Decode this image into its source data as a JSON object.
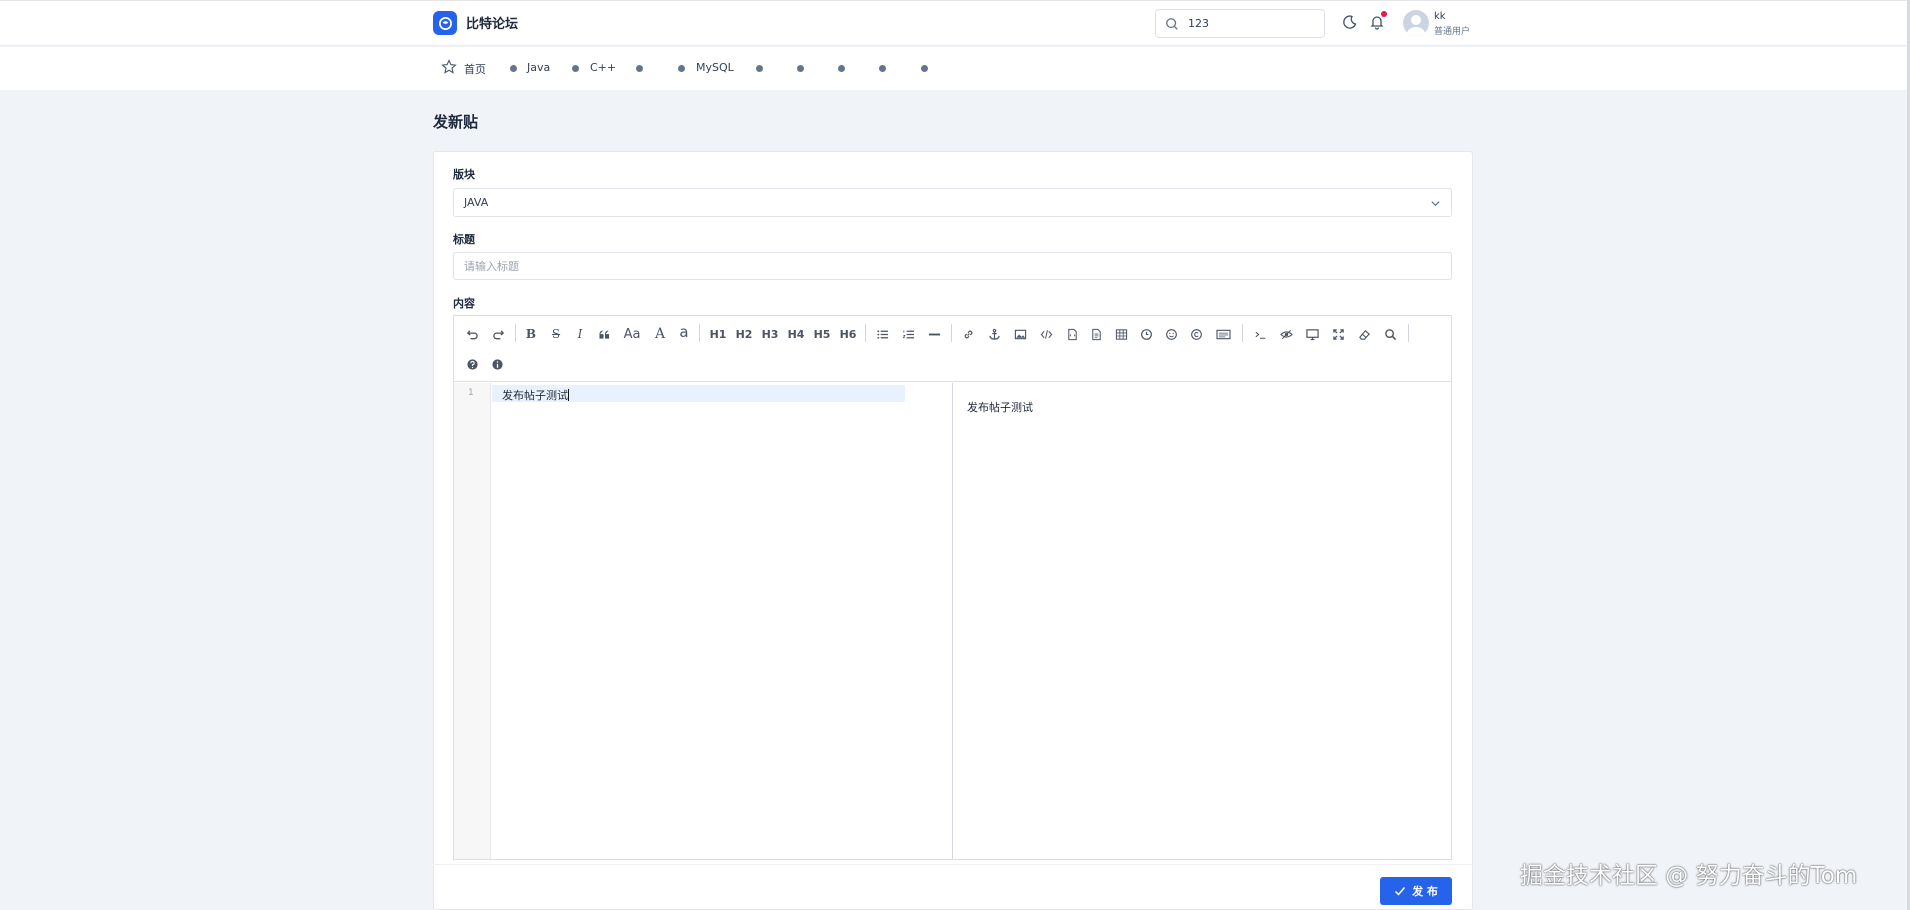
{
  "brand": {
    "name": "比特论坛",
    "icon": "chat-bubble-logo-icon",
    "color": "#2563eb"
  },
  "header": {
    "search_value": "123",
    "user": {
      "name": "kk",
      "role": "普通用户"
    },
    "notification_badge": true
  },
  "nav": {
    "items": [
      {
        "label": "首页",
        "icon": "star-icon"
      },
      {
        "label": "Java"
      },
      {
        "label": "C++"
      },
      {
        "label": ""
      },
      {
        "label": "MySQL"
      },
      {
        "label": ""
      },
      {
        "label": ""
      },
      {
        "label": ""
      },
      {
        "label": ""
      },
      {
        "label": ""
      }
    ]
  },
  "page": {
    "title": "发新贴"
  },
  "form": {
    "board_label": "版块",
    "board_value": "JAVA",
    "title_label": "标题",
    "title_placeholder": "请输入标题",
    "content_label": "内容"
  },
  "editor": {
    "toolbar": [
      "undo",
      "redo",
      "bold",
      "strikethrough",
      "italic",
      "quote",
      "uppercase",
      "fontsize",
      "lowercase",
      "H1",
      "H2",
      "H3",
      "H4",
      "H5",
      "H6",
      "unordered-list",
      "ordered-list",
      "horizontal-rule",
      "link",
      "anchor",
      "image",
      "code",
      "preformatted",
      "code-block",
      "table",
      "datetime",
      "emoji",
      "html-entities",
      "pagebreak",
      "goto-line",
      "watch",
      "preview",
      "fullscreen",
      "clear",
      "search",
      "help",
      "info"
    ],
    "headings": [
      "H1",
      "H2",
      "H3",
      "H4",
      "H5",
      "H6"
    ],
    "line_number": "1",
    "markdown": "发布帖子测试",
    "preview": "发布帖子测试"
  },
  "actions": {
    "publish_label": "发 布"
  },
  "watermark": "掘金技术社区 @ 努力奋斗的Tom"
}
